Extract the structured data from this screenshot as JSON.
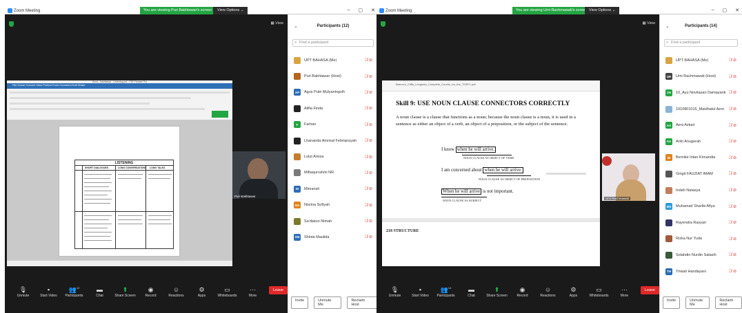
{
  "windows": [
    {
      "app_title": "Zoom Meeting",
      "banner": "You are viewing Puri Bakhtawar's screen",
      "view_options": "View Options ⌄",
      "view_label": "View",
      "doc_title": "Word - bakhtawar - Listening.pdf - PDF Reader Pro",
      "doc_menu": "File  Home  Convert  View  Protect  Form  Comment  Edit  Share",
      "listening_title": "LISTENING",
      "listening_columns": [
        "SHORT DIALOGUES",
        "LONG CONVERSATIONS",
        "LONG TALKS"
      ],
      "camera_name": "Puri Bakhtawar",
      "panel_title": "Participants (12)",
      "search_placeholder": "Find a participant",
      "participants": [
        {
          "name": "UPT BAHASA (Me)",
          "initials": "",
          "color": "#d9a441"
        },
        {
          "name": "Puri Bakhtawar (Host)",
          "initials": "",
          "color": "#b5651d"
        },
        {
          "name": "Agus Putri Mulyaningsih",
          "initials": "AP",
          "color": "#2d6db5"
        },
        {
          "name": "Alifia Finda",
          "initials": "",
          "color": "#222222"
        },
        {
          "name": "Farhan",
          "initials": "F",
          "color": "#23a543"
        },
        {
          "name": "Lhananda Amrisal Febriansyah",
          "initials": "",
          "color": "#222222"
        },
        {
          "name": "Lulut Amiza",
          "initials": "",
          "color": "#c47d2c"
        },
        {
          "name": "Miftaqurrahmi NR",
          "initials": "",
          "color": "#7a7a7a"
        },
        {
          "name": "Mimansti",
          "initials": "M",
          "color": "#2d6db5"
        },
        {
          "name": "Nisrina Sofiyah",
          "initials": "NS",
          "color": "#e0821a"
        },
        {
          "name": "Sa'diatun Nimah",
          "initials": "",
          "color": "#7a7a2a"
        },
        {
          "name": "Shinta Maulida",
          "initials": "SM",
          "color": "#2d6db5"
        }
      ],
      "buttons": {
        "invite": "Invite",
        "mute_all": "Unmute Me",
        "reclaim": "Reclaim Host"
      },
      "toolbar": [
        {
          "label": "Unmute",
          "icon": "mic-off"
        },
        {
          "label": "Start Video",
          "icon": "video-off"
        },
        {
          "label": "Participants",
          "icon": "people"
        },
        {
          "label": "Chat",
          "icon": "chat"
        },
        {
          "label": "Share Screen",
          "icon": "share"
        },
        {
          "label": "Record",
          "icon": "record"
        },
        {
          "label": "Reactions",
          "icon": "reactions"
        },
        {
          "label": "Apps",
          "icon": "apps"
        },
        {
          "label": "Whiteboards",
          "icon": "whiteboard"
        },
        {
          "label": "More",
          "icon": "more"
        }
      ],
      "participant_count": "12",
      "leave": "Leave"
    },
    {
      "app_title": "Zoom Meeting",
      "banner": "You are viewing Umi Rachmawati's screen",
      "view_options": "View Options ⌄",
      "view_label": "View",
      "doc_head": "Barron's_Cliffs_Longman_Complete_Course_for_the_TOEFL.pdf",
      "skill_title": "Skill 9:   USE NOUN CLAUSE CONNECTORS CORRECTLY",
      "paragraph": "A noun clause is a clause that functions as a noun; because the noun clause is a noun, it is used in a sentence as either an object of a verb, an object of a preposition, or the subject of the sentence.",
      "ex1_pre": "I know",
      "ex1_box": "when he will arrive.",
      "ex1_cap": "NOUN CLAUSE AS OBJECT OF VERB",
      "ex2_pre": "I am concerned about",
      "ex2_box": "when he will arrive.",
      "ex2_cap": "NOUN CLAUSE AS OBJECT OF PREPOSITION",
      "ex3_box": "When he will arrive",
      "ex3_post": "is not important.",
      "ex3_cap": "NOUN CLAUSE AS SUBJECT",
      "structure": "218    STRUCTURE",
      "camera_name": "Umi Rachmawati",
      "panel_title": "Participants (14)",
      "search_placeholder": "Find a participant",
      "participants": [
        {
          "name": "UPT BAHASA (Me)",
          "initials": "",
          "color": "#d9a441"
        },
        {
          "name": "Umi Rachmawati (Host)",
          "initials": "UR",
          "color": "#444444"
        },
        {
          "name": "10_Ayu Novitasari Damayanti",
          "initials": "1N",
          "color": "#23a543"
        },
        {
          "name": "1910801015_Maidhatul Aeni",
          "initials": "",
          "color": "#8ab4d8"
        },
        {
          "name": "Aeni Azkari",
          "initials": "AA",
          "color": "#23a543"
        },
        {
          "name": "Arlin Anugerah",
          "initials": "AA",
          "color": "#23a543"
        },
        {
          "name": "Bernike Intan Kirnandia",
          "initials": "BI",
          "color": "#e0821a"
        },
        {
          "name": "Gingit FAUZIAT IMAM",
          "initials": "",
          "color": "#555555"
        },
        {
          "name": "Indah Natasya",
          "initials": "",
          "color": "#c47d5c"
        },
        {
          "name": "Muhamad Sharibi Afiya",
          "initials": "MS",
          "color": "#2d9bd8"
        },
        {
          "name": "Rayendra Rasyari",
          "initials": "",
          "color": "#333366"
        },
        {
          "name": "Rizka Nur Yuda",
          "initials": "",
          "color": "#a05a3a"
        },
        {
          "name": "Solahdin Nurdin Salasih",
          "initials": "",
          "color": "#3a5a3a"
        },
        {
          "name": "Triwati Handayani",
          "initials": "TH",
          "color": "#2d6db5"
        }
      ],
      "buttons": {
        "invite": "Invite",
        "mute_all": "Unmute Me",
        "reclaim": "Reclaim Host"
      },
      "toolbar": [
        {
          "label": "Unmute",
          "icon": "mic-off"
        },
        {
          "label": "Start Video",
          "icon": "video-off"
        },
        {
          "label": "Participants",
          "icon": "people"
        },
        {
          "label": "Chat",
          "icon": "chat"
        },
        {
          "label": "Share Screen",
          "icon": "share"
        },
        {
          "label": "Record",
          "icon": "record"
        },
        {
          "label": "Reactions",
          "icon": "reactions"
        },
        {
          "label": "Apps",
          "icon": "apps"
        },
        {
          "label": "Whiteboards",
          "icon": "whiteboard"
        },
        {
          "label": "More",
          "icon": "more"
        }
      ],
      "participant_count": "14",
      "leave": "Leave"
    }
  ],
  "icons": {
    "mic-off": "🎙",
    "video-off": "▪",
    "people": "👥",
    "chat": "▬",
    "share": "⬆",
    "record": "◉",
    "reactions": "☺",
    "apps": "⚙",
    "whiteboard": "▭",
    "more": "⋯"
  },
  "colors": {
    "banner_green": "#23a543",
    "leave_red": "#e02828",
    "zoom_blue": "#2d8cff"
  }
}
